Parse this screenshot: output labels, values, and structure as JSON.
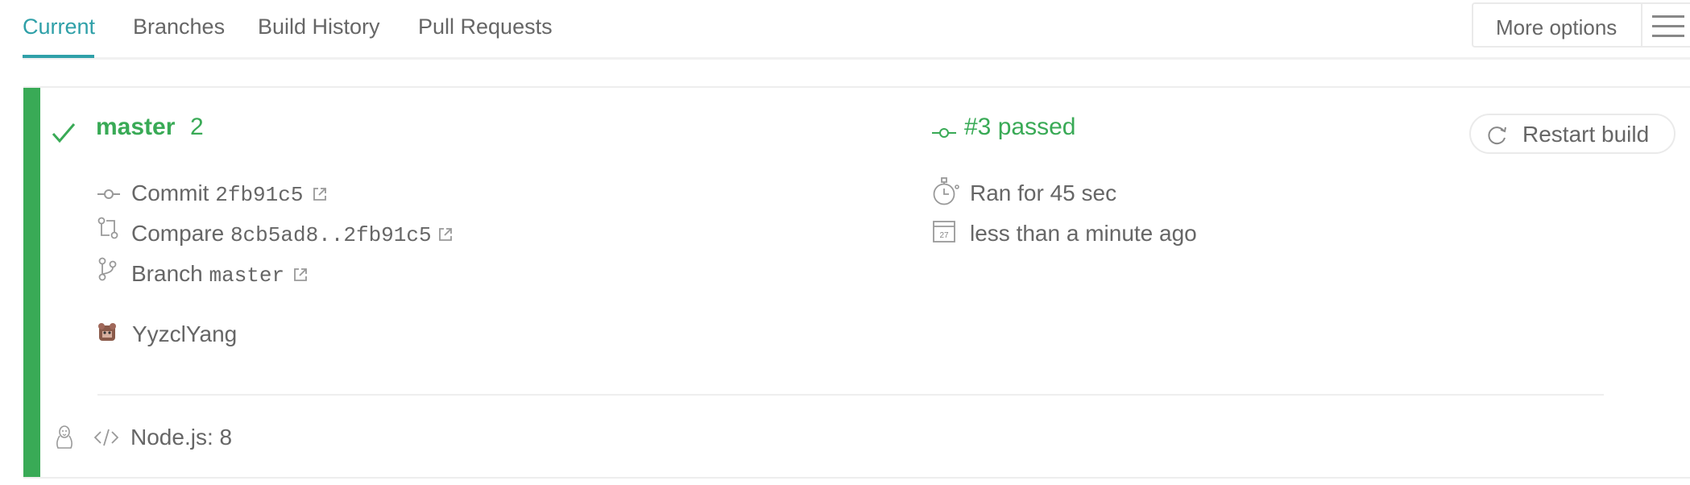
{
  "tabs": [
    {
      "label": "Current",
      "active": true
    },
    {
      "label": "Branches",
      "active": false
    },
    {
      "label": "Build History",
      "active": false
    },
    {
      "label": "Pull Requests",
      "active": false
    }
  ],
  "more_options": {
    "label": "More options",
    "icon": "hamburger-icon"
  },
  "build": {
    "status": "passed",
    "status_color": "#39aa56",
    "branch_name": "master",
    "branch_builds": "2",
    "build_state": "#3 passed",
    "restart_label": "Restart build",
    "commit": {
      "label": "Commit",
      "hash": "2fb91c5"
    },
    "compare": {
      "label": "Compare",
      "range": "8cb5ad8..2fb91c5"
    },
    "branch": {
      "label": "Branch",
      "name": "master"
    },
    "duration": "Ran for 45 sec",
    "calendar_day": "27",
    "finished": "less than a minute ago",
    "author": "YyzclYang",
    "job": {
      "os": "linux",
      "language": "Node.js: 8"
    }
  },
  "colors": {
    "accent": "#2fa0a8",
    "passed": "#39aa56",
    "text": "#666666",
    "border": "#eaeaea"
  }
}
